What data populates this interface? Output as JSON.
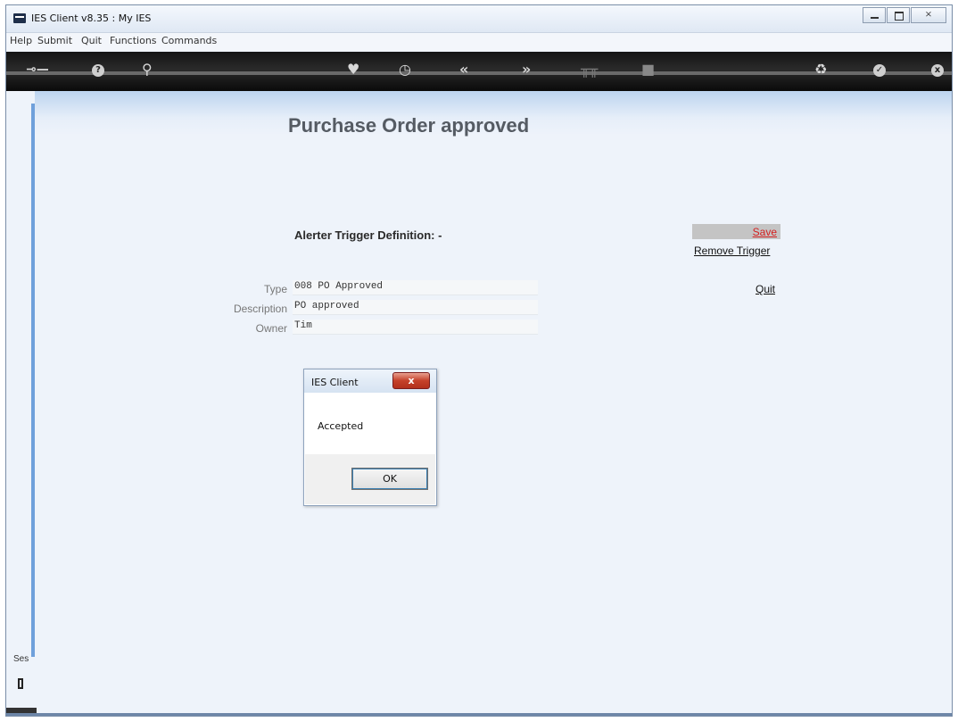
{
  "window": {
    "title": "IES Client v8.35 : My IES"
  },
  "menu": {
    "items": [
      "Help",
      "Submit",
      "Quit",
      "Functions",
      "Commands"
    ]
  },
  "toolbar": {
    "icons": [
      "key-icon",
      "help-icon",
      "search-icon",
      "heart-icon",
      "clock-icon",
      "rewind-icon",
      "fast-forward-icon",
      "tools-icon",
      "stop-icon",
      "recycle-icon",
      "check-icon",
      "close-icon"
    ],
    "help_glyph": "?",
    "back_glyph": "«",
    "forward_glyph": "»",
    "close_glyph": "x"
  },
  "page": {
    "title": "Purchase Order approved",
    "section_label": "Alerter Trigger Definition: -",
    "save_label": "Save",
    "remove_trigger_label": "Remove Trigger",
    "quit_label": "Quit",
    "fields": [
      {
        "label": "Type",
        "value": "008 PO Approved"
      },
      {
        "label": "Description",
        "value": "PO approved"
      },
      {
        "label": "Owner",
        "value": "Tim"
      }
    ]
  },
  "sidebar": {
    "session_label": "Ses"
  },
  "dialog": {
    "title": "IES Client",
    "message": "Accepted",
    "ok_label": "OK",
    "close_glyph": "x"
  },
  "colors": {
    "background": "#eef3fa",
    "header_gradient_top": "#bcd4ef",
    "save_link": "#d41f1f",
    "save_box": "#c4c4c4",
    "toolbar": "#151515"
  }
}
